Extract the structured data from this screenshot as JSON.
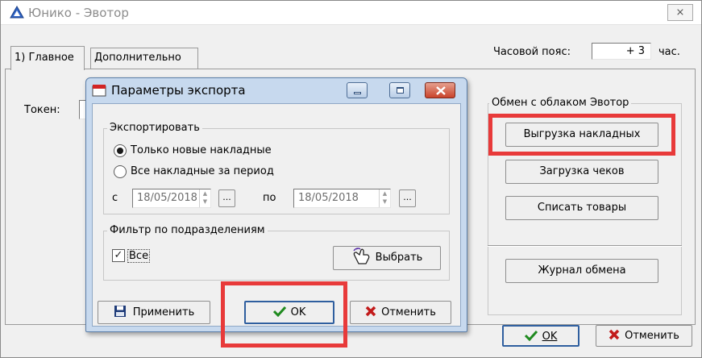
{
  "main_window": {
    "title": "Юнико - Эвотор",
    "close_glyph": "⨯",
    "tabs": [
      {
        "label": "1) Главное"
      },
      {
        "label": "Дополнительно"
      }
    ],
    "timezone": {
      "label": "Часовой пояс:",
      "value": "+ 3",
      "unit": "час."
    },
    "token_label": "Токен:",
    "cloud_group": {
      "legend": "Обмен с облаком Эвотор",
      "buttons": [
        "Выгрузка накладных",
        "Загрузка чеков",
        "Списать товары",
        "Журнал обмена"
      ]
    },
    "ok_label": "OK",
    "cancel_label": "Отменить"
  },
  "dialog": {
    "title": "Параметры экспорта",
    "export_group": {
      "legend": "Экспортировать",
      "options": [
        "Только новые накладные",
        "Все накладные за период"
      ],
      "selected_index": 0,
      "from_label": "с",
      "to_label": "по",
      "date_from": "18/05/2018",
      "date_to": "18/05/2018",
      "ellipsis": "..."
    },
    "filter_group": {
      "legend": "Фильтр по подразделениям",
      "all_label": "Все",
      "all_checked": true,
      "choose_label": "Выбрать"
    },
    "apply_label": "Применить",
    "ok_label": "OK",
    "cancel_label": "Отменить"
  },
  "colors": {
    "highlight": "#e83a3a",
    "ok_check": "#1f8a1f",
    "cancel_x": "#c21a1a",
    "dialog_frame": "#c7d9ee",
    "window_close_red": "#c9432b"
  }
}
